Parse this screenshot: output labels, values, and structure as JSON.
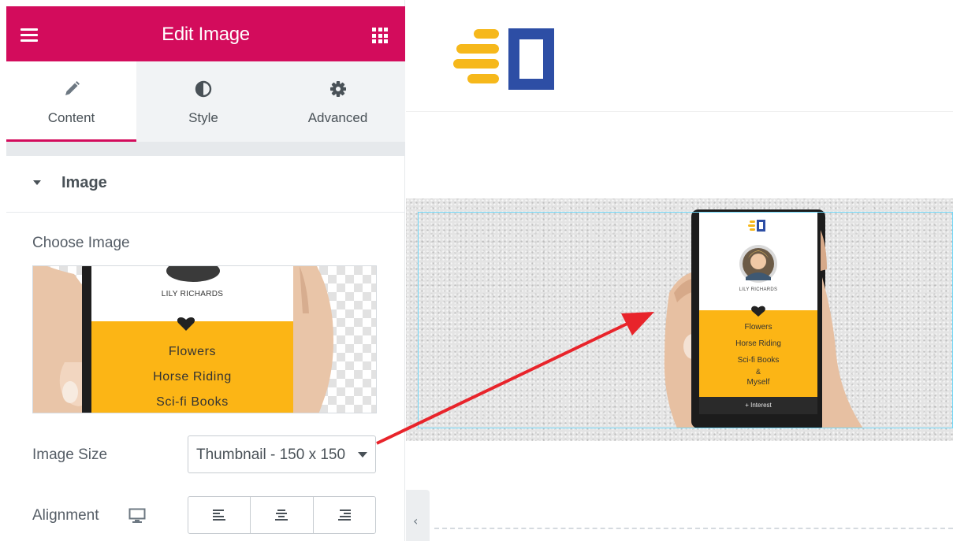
{
  "panel": {
    "title": "Edit Image",
    "tabs": [
      {
        "label": "Content",
        "icon": "pencil-icon",
        "active": true
      },
      {
        "label": "Style",
        "icon": "contrast-icon",
        "active": false
      },
      {
        "label": "Advanced",
        "icon": "gear-icon",
        "active": false
      }
    ],
    "section": {
      "label": "Image",
      "expanded": true
    },
    "choose_image_label": "Choose Image",
    "image_size": {
      "label": "Image Size",
      "value": "Thumbnail - 150 x 150"
    },
    "alignment": {
      "label": "Alignment",
      "device_icon": "desktop-icon",
      "options": [
        "left",
        "center",
        "right"
      ]
    },
    "preview": {
      "name": "LILY RICHARDS",
      "interests": [
        "Flowers",
        "Horse Riding",
        "Sci-fi Books"
      ]
    }
  },
  "canvas": {
    "phone": {
      "name": "LILY RICHARDS",
      "interests": [
        "Flowers",
        "Horse Riding",
        "Sci-fi Books",
        "&",
        "Myself"
      ],
      "footer": "+ Interest"
    }
  },
  "colors": {
    "accent": "#d30c5c",
    "logo_yellow": "#f6b81b",
    "logo_blue": "#2d4ea5",
    "card_yellow": "#fcb515",
    "selection": "#71d7f7",
    "arrow": "#e8242b"
  }
}
